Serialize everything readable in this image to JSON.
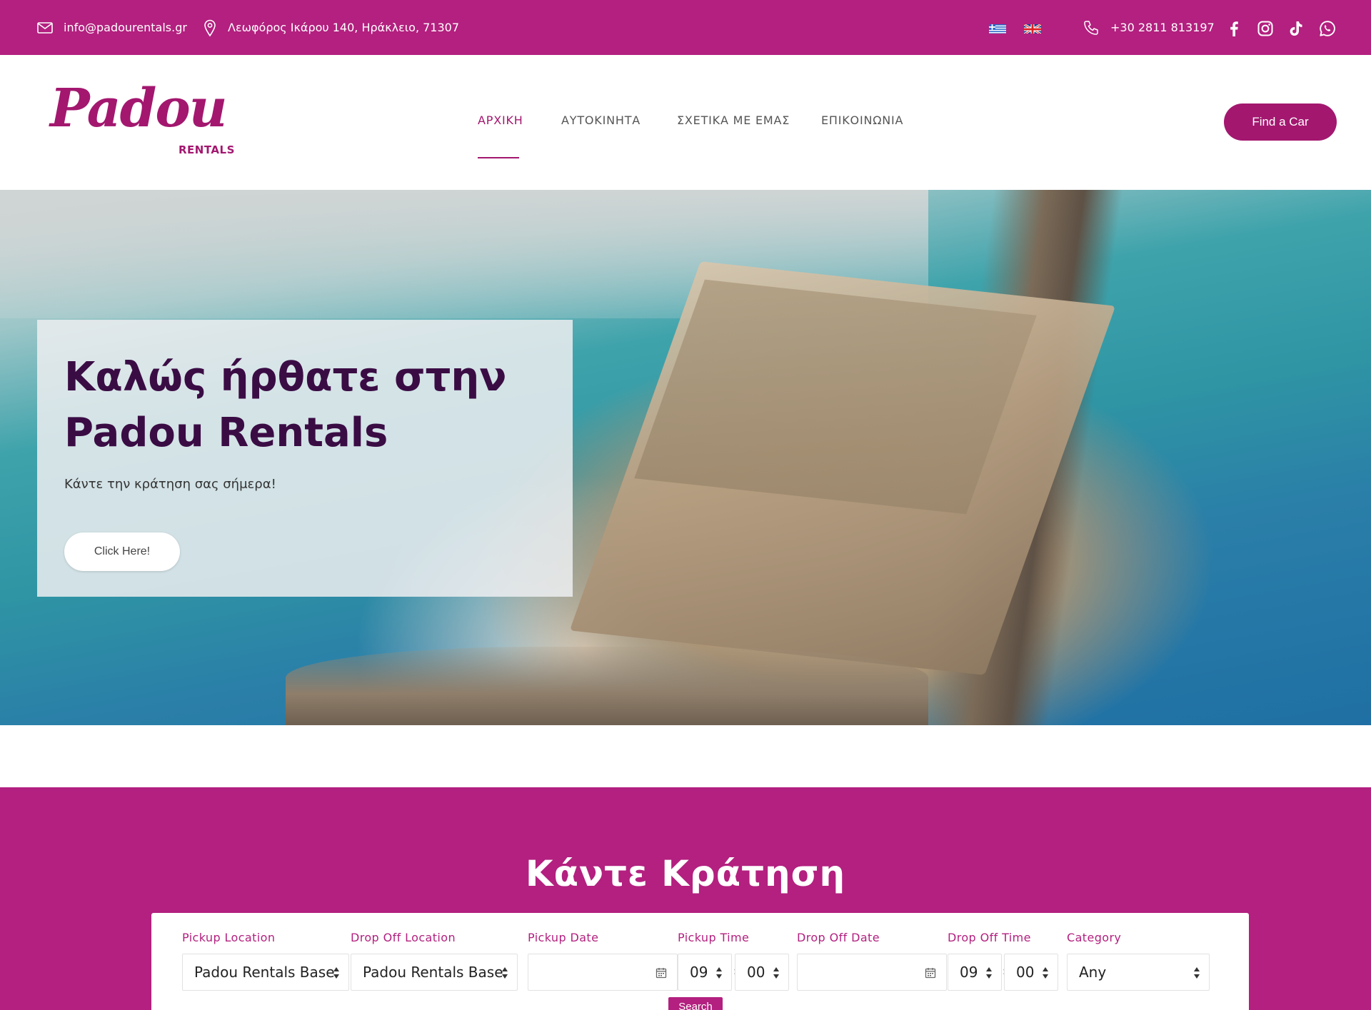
{
  "topbar": {
    "email": "info@padourentals.gr",
    "address": "Λεωφόρος Ικάρου 140, Ηράκλειο, 71307",
    "phone": "+30 2811 813197",
    "languages": [
      "el",
      "en"
    ],
    "social_icons": [
      "facebook-icon",
      "instagram-icon",
      "tiktok-icon",
      "whatsapp-icon"
    ]
  },
  "header": {
    "logo_word": "Padou",
    "logo_sub": "RENTALS",
    "nav": [
      {
        "label": "ΑΡΧΙΚΗ",
        "active": true
      },
      {
        "label": "ΑΥΤΟΚΙΝΗΤΑ",
        "active": false
      },
      {
        "label": "ΣΧΕΤΙΚΑ ΜΕ ΕΜΑΣ",
        "active": false
      },
      {
        "label": "ΕΠΙΚΟΙΝΩΝΙΑ",
        "active": false
      }
    ],
    "cta": "Find a Car"
  },
  "hero": {
    "title": "Καλώς ήρθατε στην Padou Rentals",
    "subtitle": "Κάντε την κράτηση σας σήμερα!",
    "button": "Click Here!"
  },
  "booking": {
    "title": "Κάντε Κράτηση",
    "labels": {
      "pickup_location": "Pickup Location",
      "dropoff_location": "Drop Off Location",
      "pickup_date": "Pickup Date",
      "pickup_time": "Pickup Time",
      "dropoff_date": "Drop Off Date",
      "dropoff_time": "Drop Off Time",
      "category": "Category"
    },
    "values": {
      "pickup_location": "Padou Rentals Base",
      "dropoff_location": "Padou Rentals Base",
      "pickup_date": "",
      "pickup_hour": "09",
      "pickup_minute": "00",
      "dropoff_date": "",
      "dropoff_hour": "09",
      "dropoff_minute": "00",
      "category": "Any",
      "time_separator": ":"
    },
    "search_label": "Search"
  },
  "colors": {
    "brand": "#b3207f",
    "brand_dark": "#a3176f",
    "hero_title": "#3a0c44"
  }
}
